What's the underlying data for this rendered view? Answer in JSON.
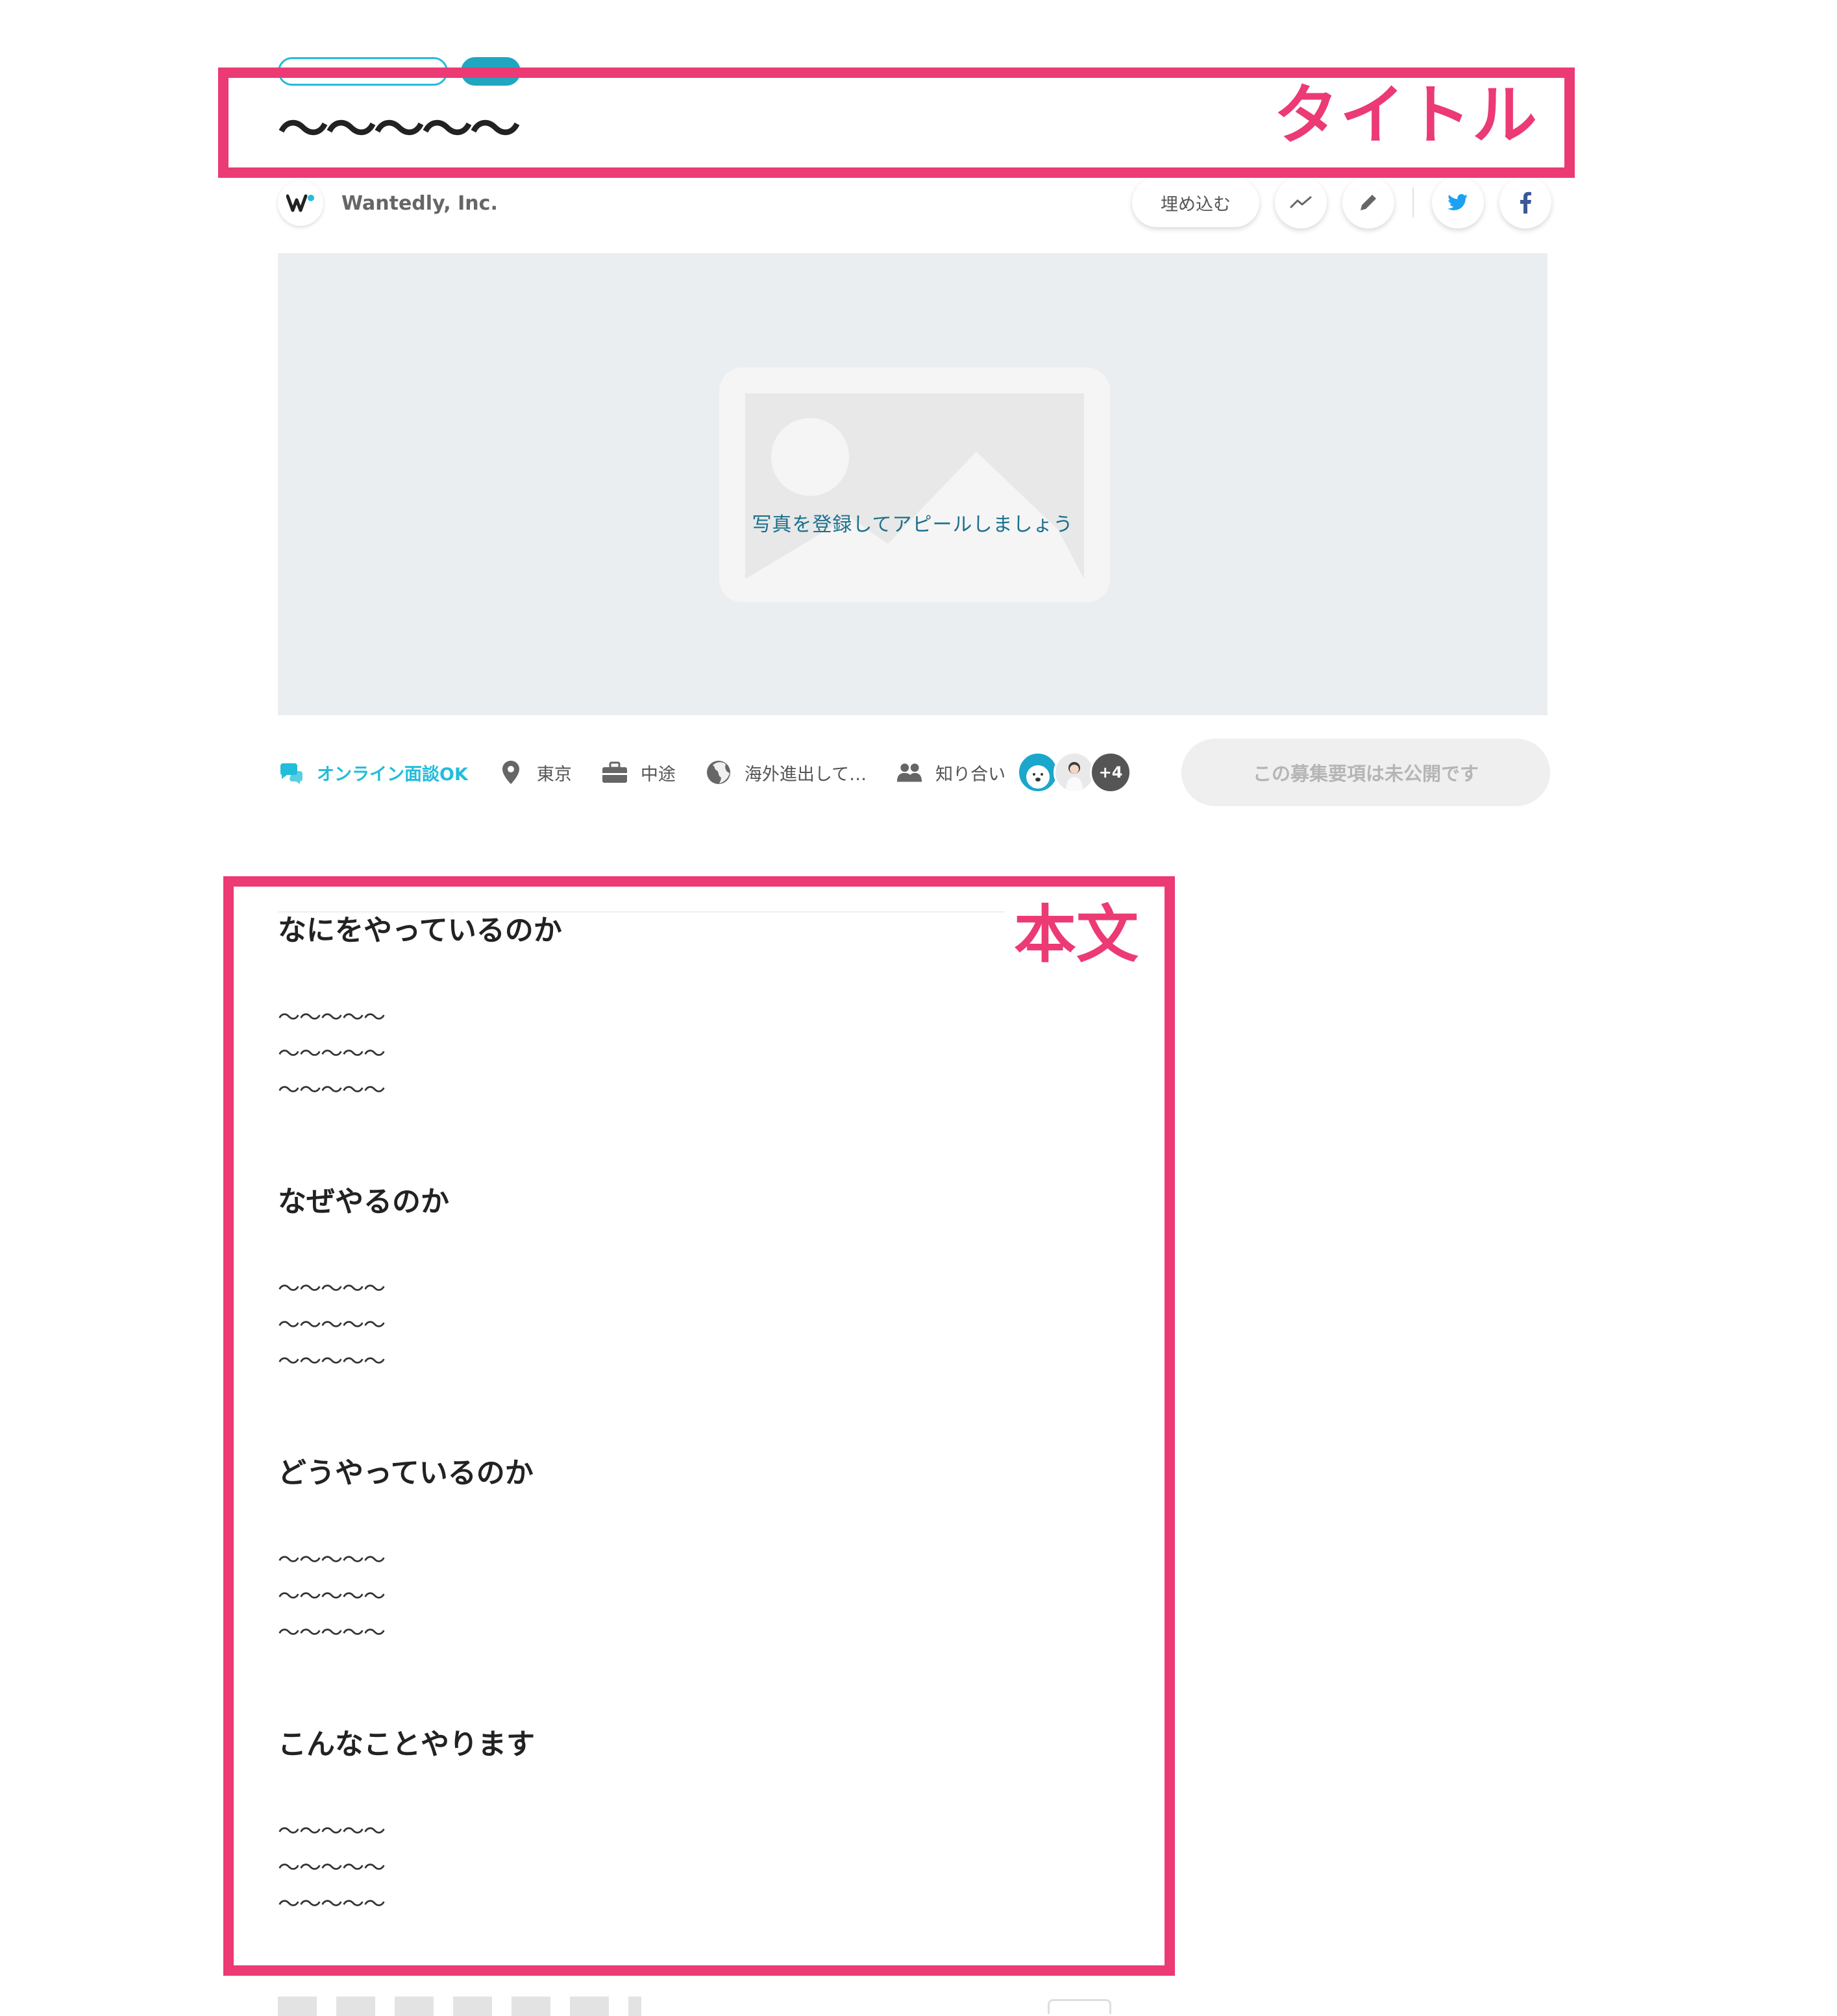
{
  "post": {
    "title": "〜〜〜〜〜"
  },
  "annotations": {
    "title_label": "タイトル",
    "body_label": "本文",
    "color": "#ec3a74"
  },
  "company": {
    "name": "Wantedly, Inc.",
    "logo_icon": "wantedly-logo-icon"
  },
  "actions": {
    "embed_label": "埋め込む",
    "analytics_icon": "trend-line-icon",
    "edit_icon": "pencil-icon",
    "twitter_icon": "twitter-icon",
    "facebook_icon": "facebook-icon"
  },
  "cover": {
    "placeholder_text": "写真を登録してアピールしましょう"
  },
  "meta": {
    "online_label": "オンライン面談OK",
    "location": "東京",
    "employment_type": "中途",
    "overseas": "海外進出して…",
    "acquaintances_label": "知り合い",
    "more_count": "+4"
  },
  "status": {
    "label": "この募集要項は未公開です"
  },
  "sections": [
    {
      "title": "なにをやっているのか",
      "lines": [
        "〜〜〜〜〜",
        "〜〜〜〜〜",
        "〜〜〜〜〜"
      ]
    },
    {
      "title": "なぜやるのか",
      "lines": [
        "〜〜〜〜〜",
        "〜〜〜〜〜",
        "〜〜〜〜〜"
      ]
    },
    {
      "title": "どうやっているのか",
      "lines": [
        "〜〜〜〜〜",
        "〜〜〜〜〜",
        "〜〜〜〜〜"
      ]
    },
    {
      "title": "こんなことやります",
      "lines": [
        "〜〜〜〜〜",
        "〜〜〜〜〜",
        "〜〜〜〜〜"
      ]
    }
  ],
  "colors": {
    "accent": "#21bddb",
    "twitter": "#1da1f2",
    "facebook": "#3b5998"
  }
}
